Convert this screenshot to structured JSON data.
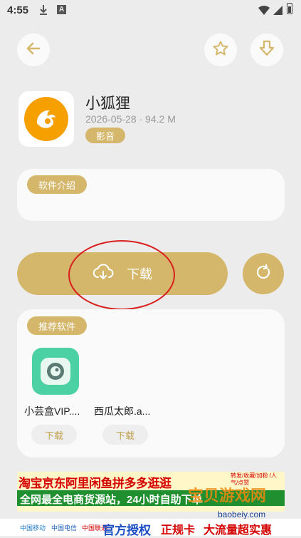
{
  "status_bar": {
    "time": "4:55",
    "download_icon": "download-status-icon",
    "notification_icon": "a-notification-icon"
  },
  "app": {
    "name": "小狐狸",
    "meta": "2026-05-28 · 94.2 M",
    "category": "影音"
  },
  "intro": {
    "label": "软件介绍"
  },
  "download": {
    "label": "下载"
  },
  "recommend": {
    "label": "推荐软件",
    "items": [
      {
        "name": "小芸盒VIP....",
        "button": "下载"
      },
      {
        "name": "西瓜太郎.a...",
        "button": "下载"
      }
    ]
  },
  "banner": {
    "line1": "淘宝京东阿里闲鱼拼多多逛逛",
    "line1_side": "转发/收藏/加粉 /人气/点赞",
    "line2": "全网最全电商货源站，24小时自助下单",
    "watermark": "宝贝游戏网",
    "site": "baobeiy.com",
    "carriers": [
      "中国移动",
      "中国电信",
      "中国联通"
    ],
    "slogan1": "官方授权",
    "slogan2": "正规卡",
    "slogan3": "大流量超实惠"
  },
  "colors": {
    "accent": "#d4b76b",
    "fox_orange": "#f6a000",
    "annotation_red": "#d92020"
  }
}
